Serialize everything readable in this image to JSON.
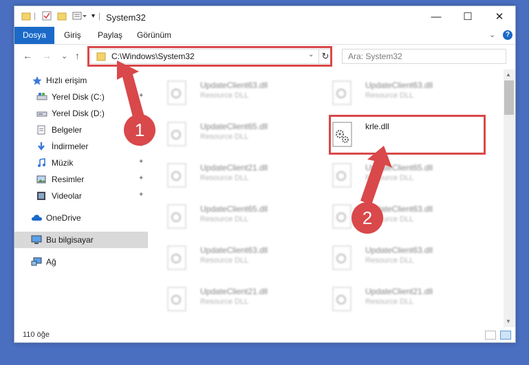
{
  "window": {
    "title": "System32",
    "minimize_glyph": "—",
    "maximize_glyph": "☐",
    "close_glyph": "✕"
  },
  "ribbon": {
    "tabs": [
      "Dosya",
      "Giriş",
      "Paylaş",
      "Görünüm"
    ],
    "expand_glyph": "⌄",
    "help_glyph": "?"
  },
  "address": {
    "path": "C:\\Windows\\System32",
    "search_placeholder": "Ara: System32",
    "back_glyph": "←",
    "forward_glyph": "→",
    "recent_glyph": "⌄",
    "up_glyph": "↑",
    "dropdown_glyph": "⌄",
    "refresh_glyph": "↻"
  },
  "sidebar": {
    "pin_glyph": "📌",
    "items": [
      {
        "label": "Hızlı erişim",
        "icon": "star-icon"
      },
      {
        "label": "Yerel Disk (C:)",
        "icon": "drive-icon"
      },
      {
        "label": "Yerel Disk (D:)",
        "icon": "drive-icon"
      },
      {
        "label": "Belgeler",
        "icon": "documents-icon"
      },
      {
        "label": "İndirmeler",
        "icon": "download-icon"
      },
      {
        "label": "Müzik",
        "icon": "music-icon"
      },
      {
        "label": "Resimler",
        "icon": "pictures-icon"
      },
      {
        "label": "Videolar",
        "icon": "video-icon"
      },
      {
        "label": "OneDrive",
        "icon": "cloud-icon"
      },
      {
        "label": "Bu bilgisayar",
        "icon": "computer-icon"
      },
      {
        "label": "Ağ",
        "icon": "network-icon"
      }
    ]
  },
  "files": [
    {
      "name": "UpdateClient63.dll",
      "type": "Resource DLL"
    },
    {
      "name": "UpdateClient63.dll",
      "type": "Resource DLL"
    },
    {
      "name": "UpdateClient65.dll",
      "type": "Resource DLL"
    },
    {
      "name": "krle.dll",
      "type": ""
    },
    {
      "name": "UpdateClient21.dll",
      "type": "Resource DLL"
    },
    {
      "name": "UpdateClient65.dll",
      "type": "Resource DLL"
    },
    {
      "name": "UpdateClient65.dll",
      "type": "Resource DLL"
    },
    {
      "name": "UpdateClient63.dll",
      "type": "Resource DLL"
    },
    {
      "name": "UpdateClient63.dll",
      "type": "Resource DLL"
    },
    {
      "name": "UpdateClient63.dll",
      "type": "Resource DLL"
    },
    {
      "name": "UpdateClient21.dll",
      "type": "Resource DLL"
    },
    {
      "name": "UpdateClient21.dll",
      "type": "Resource DLL"
    }
  ],
  "status": {
    "count": "110 öğe"
  },
  "annotations": {
    "step1": "1",
    "step2": "2",
    "color": "#d9484a"
  },
  "colors": {
    "accent": "#1b6ac9",
    "highlight": "#d9484a"
  }
}
